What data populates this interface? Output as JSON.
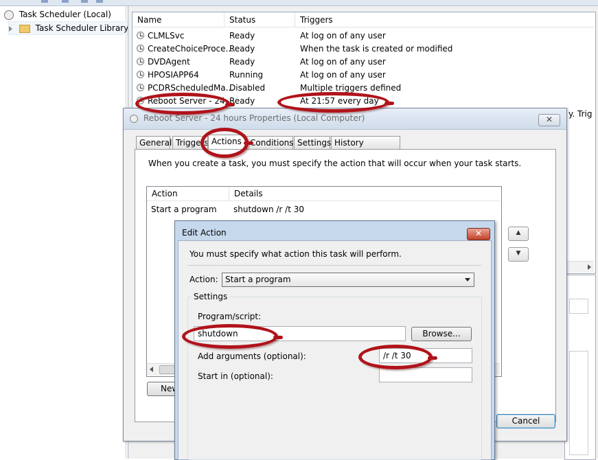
{
  "tree": {
    "root": "Task Scheduler (Local)",
    "library": "Task Scheduler Library"
  },
  "tasklist": {
    "columns": [
      "Name",
      "Status",
      "Triggers"
    ],
    "rows": [
      {
        "name": "CLMLSvc",
        "status": "Ready",
        "trigger": "At log on of any user"
      },
      {
        "name": "CreateChoiceProce...",
        "status": "Ready",
        "trigger": "When the task is created or modified"
      },
      {
        "name": "DVDAgent",
        "status": "Ready",
        "trigger": "At log on of any user"
      },
      {
        "name": "HPOSIAPP64",
        "status": "Running",
        "trigger": "At log on of any user"
      },
      {
        "name": "PCDRScheduledMa...",
        "status": "Disabled",
        "trigger": "Multiple triggers defined"
      },
      {
        "name": "Reboot Server - 24 ...",
        "status": "Ready",
        "trigger": "At 21:57 every day"
      }
    ],
    "side_text": "y. Trig"
  },
  "props": {
    "title": "Reboot Server - 24 hours Properties (Local Computer)",
    "close": "✕",
    "tabs": [
      "General",
      "Triggers",
      "Actions",
      "Conditions",
      "Settings",
      "History (disabled)"
    ],
    "instruction": "When you create a task, you must specify the action that will occur when your task starts.",
    "list_columns": [
      "Action",
      "Details"
    ],
    "list_rows": [
      {
        "action": "Start a program",
        "details": "shutdown /r /t 30"
      }
    ],
    "new_button": "New...",
    "cancel_button": "Cancel",
    "up_arrow": "▲",
    "down_arrow": "▼"
  },
  "edit": {
    "title": "Edit Action",
    "close": "✕",
    "instruction": "You must specify what action this task will perform.",
    "action_label": "Action:",
    "action_value": "Start a program",
    "settings_label": "Settings",
    "program_label": "Program/script:",
    "program_value": "shutdown",
    "browse_button": "Browse...",
    "args_label": "Add arguments (optional):",
    "args_value": "/r /t 30",
    "startin_label": "Start in (optional):",
    "startin_value": ""
  },
  "colors": {
    "annotation": "#b0131a",
    "title_text": "#6d6d6d"
  }
}
